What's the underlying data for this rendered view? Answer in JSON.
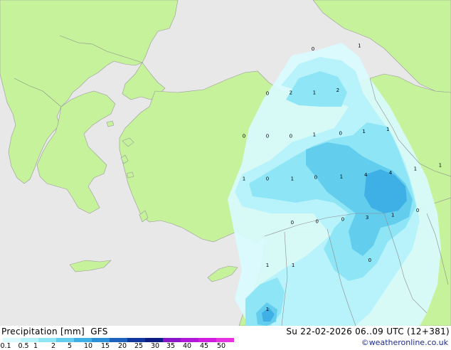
{
  "title": {
    "variable": "Precipitation [mm]",
    "model": "GFS"
  },
  "datetime": "Su 22-02-2026 06..09 UTC (12+381)",
  "credit": "©weatheronline.co.uk",
  "colorbar": {
    "labels": [
      "0.1",
      "0.5",
      "1",
      "2",
      "5",
      "10",
      "15",
      "20",
      "25",
      "30",
      "35",
      "40",
      "45",
      "50"
    ],
    "colors": [
      "#d9fbff",
      "#b6f2fb",
      "#8ee5f6",
      "#63cdee",
      "#3fb0e6",
      "#2d8fd8",
      "#1e62bd",
      "#1236a0",
      "#0b1d82",
      "#8a14c9",
      "#b116d9",
      "#d11bde",
      "#e632e0"
    ]
  },
  "map_colors": {
    "sea": "#e8e8e8",
    "land": "#c5f29a",
    "border": "#9a9a9a"
  },
  "map_labels": [
    {
      "text": "0",
      "lon": 0.694,
      "lat": 0.155
    },
    {
      "text": "1",
      "lon": 0.797,
      "lat": 0.145
    },
    {
      "text": "0",
      "lon": 0.593,
      "lat": 0.292
    },
    {
      "text": "2",
      "lon": 0.645,
      "lat": 0.289
    },
    {
      "text": "1",
      "lon": 0.697,
      "lat": 0.289
    },
    {
      "text": "2",
      "lon": 0.749,
      "lat": 0.282
    },
    {
      "text": "0",
      "lon": 0.541,
      "lat": 0.422
    },
    {
      "text": "0",
      "lon": 0.593,
      "lat": 0.422
    },
    {
      "text": "0",
      "lon": 0.645,
      "lat": 0.422
    },
    {
      "text": "1",
      "lon": 0.697,
      "lat": 0.418
    },
    {
      "text": "0",
      "lon": 0.755,
      "lat": 0.414
    },
    {
      "text": "1",
      "lon": 0.807,
      "lat": 0.408
    },
    {
      "text": "1",
      "lon": 0.86,
      "lat": 0.402
    },
    {
      "text": "1",
      "lon": 0.541,
      "lat": 0.553
    },
    {
      "text": "0",
      "lon": 0.593,
      "lat": 0.553
    },
    {
      "text": "1",
      "lon": 0.648,
      "lat": 0.553
    },
    {
      "text": "0",
      "lon": 0.7,
      "lat": 0.549
    },
    {
      "text": "1",
      "lon": 0.757,
      "lat": 0.547
    },
    {
      "text": "4",
      "lon": 0.811,
      "lat": 0.541
    },
    {
      "text": "4",
      "lon": 0.866,
      "lat": 0.535
    },
    {
      "text": "1",
      "lon": 0.921,
      "lat": 0.523
    },
    {
      "text": "1",
      "lon": 0.976,
      "lat": 0.512
    },
    {
      "text": "0",
      "lon": 0.648,
      "lat": 0.688
    },
    {
      "text": "0",
      "lon": 0.703,
      "lat": 0.684
    },
    {
      "text": "0",
      "lon": 0.76,
      "lat": 0.678
    },
    {
      "text": "3",
      "lon": 0.814,
      "lat": 0.673
    },
    {
      "text": "1",
      "lon": 0.871,
      "lat": 0.665
    },
    {
      "text": "0",
      "lon": 0.926,
      "lat": 0.651
    },
    {
      "text": "0",
      "lon": 0.82,
      "lat": 0.804
    },
    {
      "text": "1",
      "lon": 0.593,
      "lat": 0.819
    },
    {
      "text": "1",
      "lon": 0.65,
      "lat": 0.819
    },
    {
      "text": "1",
      "lon": 0.593,
      "lat": 0.954
    }
  ]
}
